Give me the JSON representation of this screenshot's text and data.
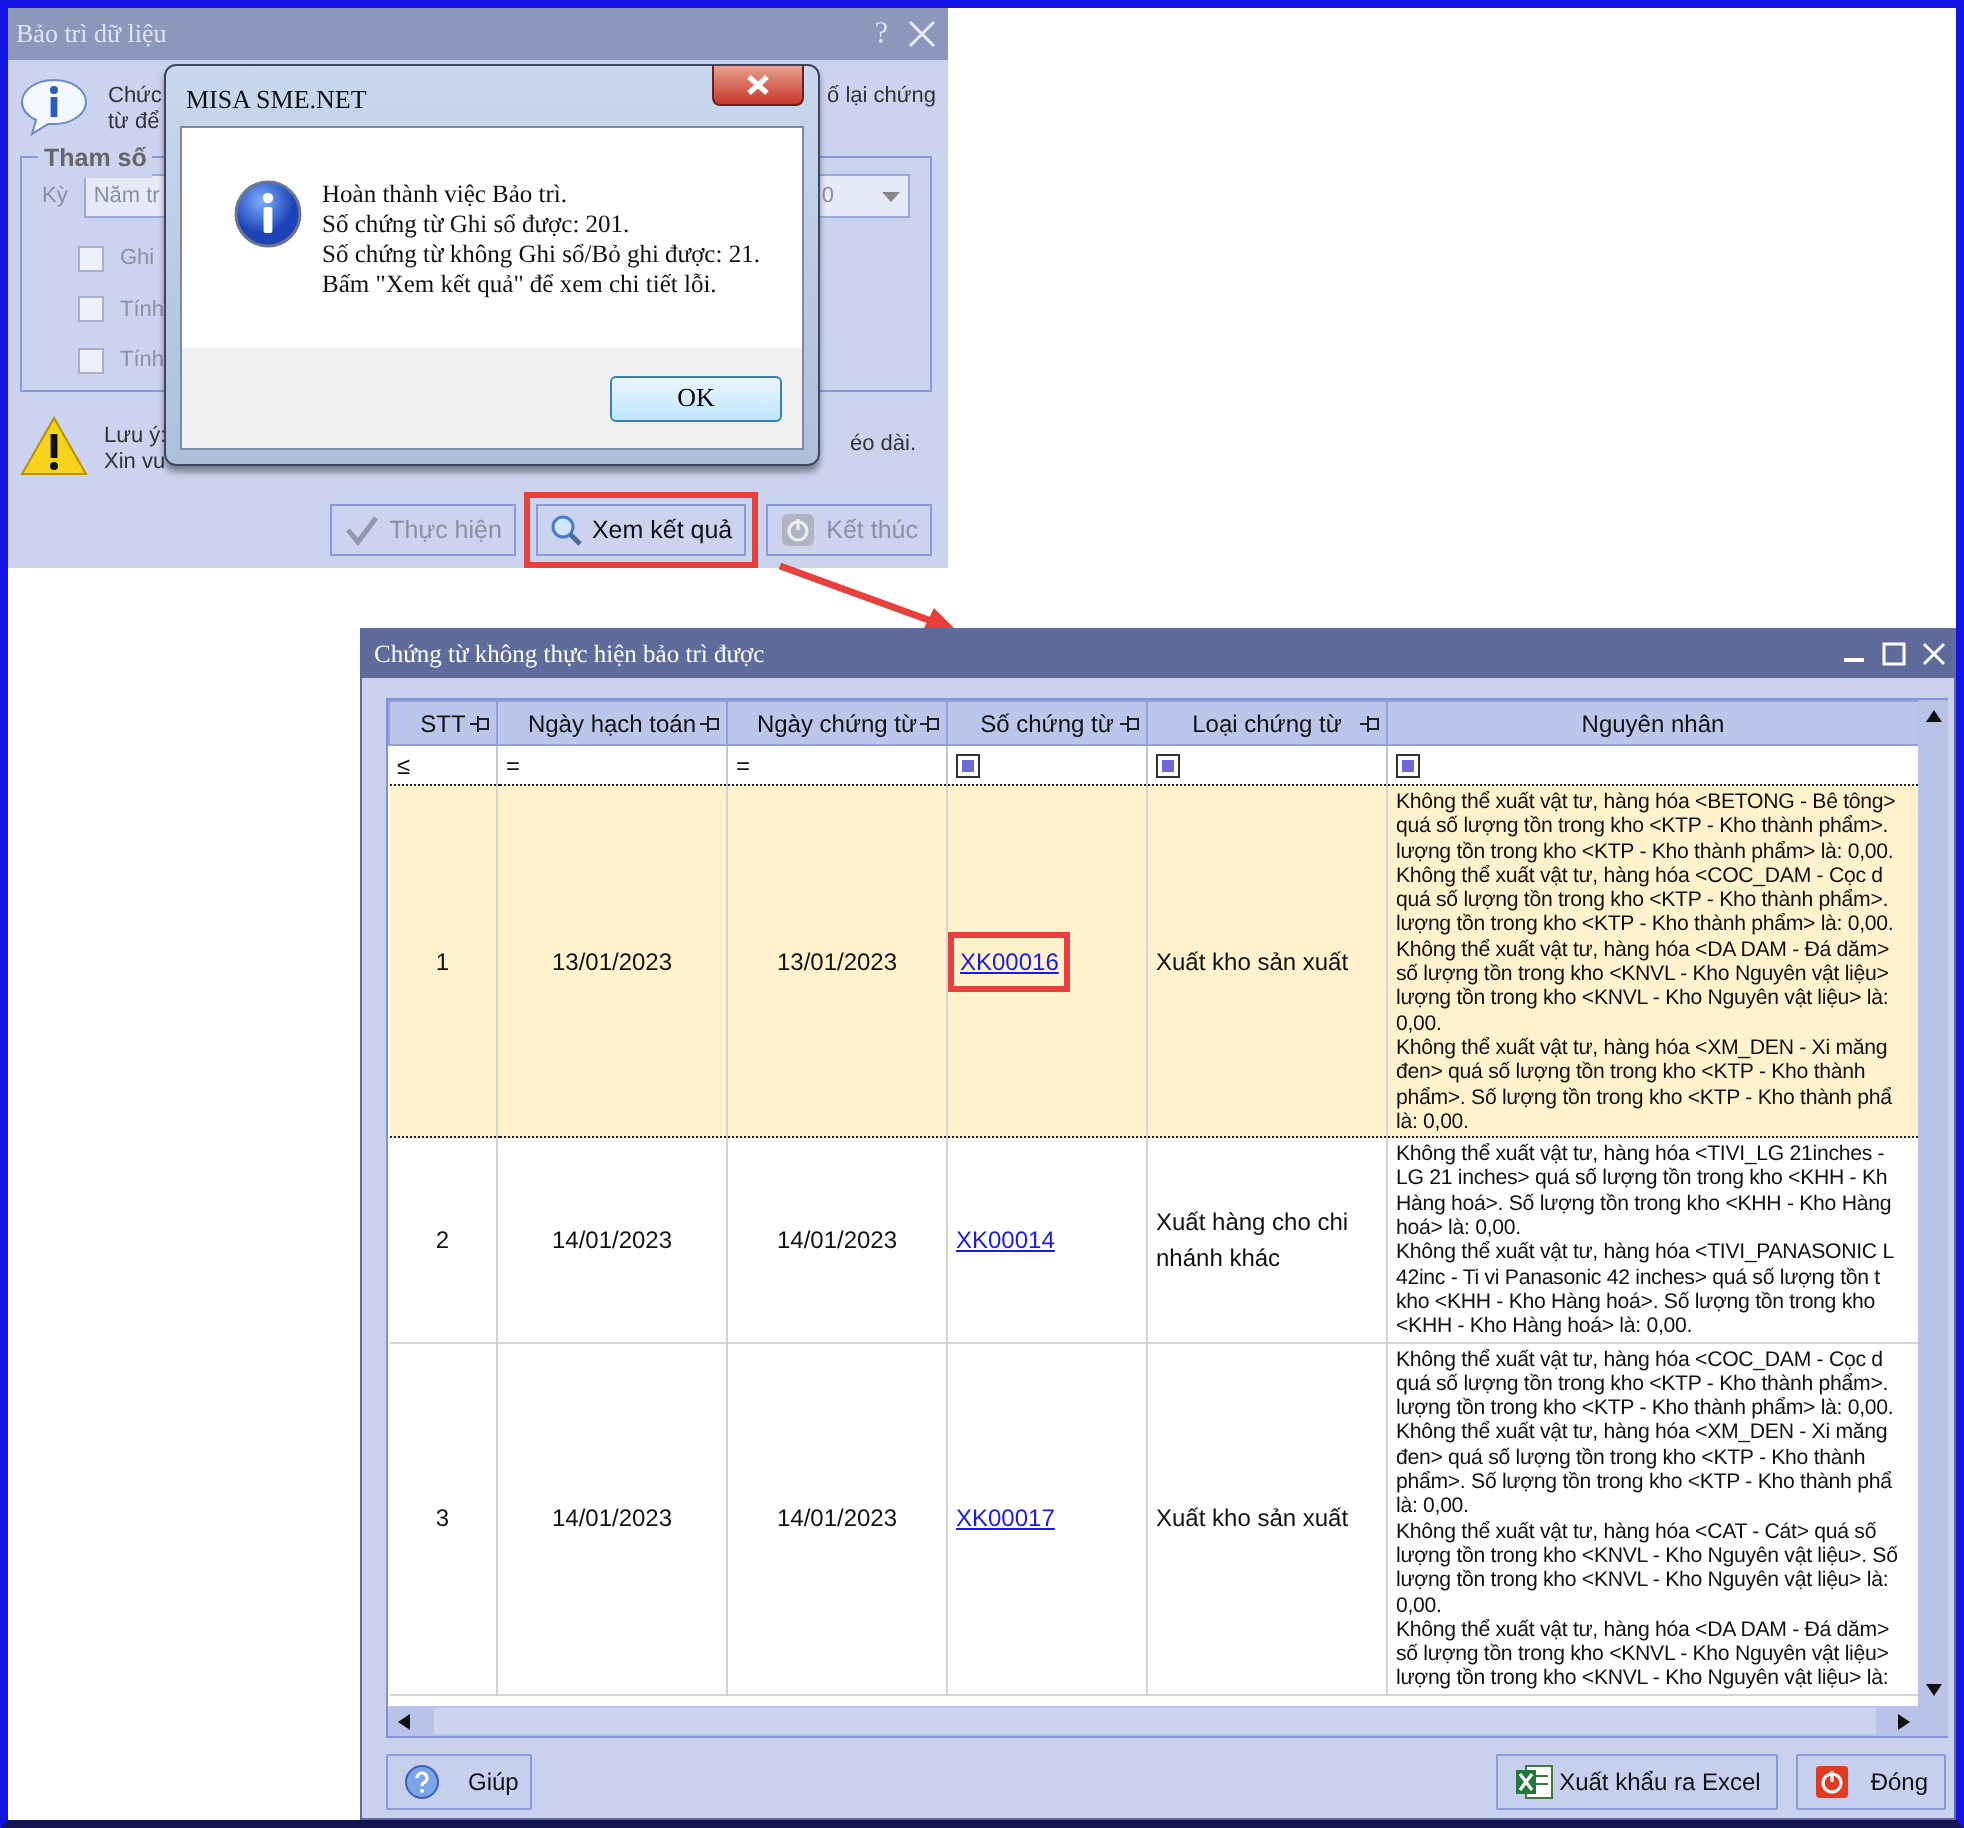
{
  "back_dialog": {
    "title": "Bảo trì dữ liệu",
    "help_mark": "?",
    "intro_lines": [
      "Chức",
      "từ để"
    ],
    "intro_tail": "ố lại chứng",
    "group_title": "Tham số",
    "period_label": "Kỳ",
    "period_value": "Năm tr",
    "period_tail": "0",
    "options": [
      {
        "label": "Ghi",
        "checked": false
      },
      {
        "label": "Tính",
        "checked": false
      },
      {
        "label": "Tính",
        "checked": false
      }
    ],
    "note_lines": [
      "Lưu ý:",
      "Xin vu"
    ],
    "note_tail": "éo dài.",
    "buttons": [
      {
        "label": "Thực hiện",
        "kind": "run",
        "disabled": true,
        "highlighted": false
      },
      {
        "label": "Xem kết quả",
        "kind": "view",
        "disabled": false,
        "highlighted": true
      },
      {
        "label": "Kết thúc",
        "kind": "stop",
        "disabled": true,
        "highlighted": false
      }
    ]
  },
  "message_box": {
    "title": "MISA SME.NET",
    "lines": [
      "Hoàn thành việc Bảo trì.",
      "Số chứng từ Ghi sổ được: 201.",
      "Số chứng từ không Ghi sổ/Bỏ ghi được: 21.",
      "Bấm \"Xem kết quả\" để xem chi tiết lỗi."
    ],
    "button": "OK"
  },
  "result_window": {
    "title": "Chứng từ không thực hiện bảo trì được",
    "columns": [
      {
        "label": "STT",
        "pin": true,
        "filter": {
          "kind": "op",
          "text": "≤"
        }
      },
      {
        "label": "Ngày hạch toán",
        "pin": true,
        "filter": {
          "kind": "op",
          "text": "="
        }
      },
      {
        "label": "Ngày chứng từ",
        "pin": true,
        "filter": {
          "kind": "op",
          "text": "="
        }
      },
      {
        "label": "Số chứng từ",
        "pin": true,
        "filter": {
          "kind": "box"
        }
      },
      {
        "label": "Loại chứng từ",
        "pin": true,
        "filter": {
          "kind": "box"
        }
      },
      {
        "label": "Nguyên nhân",
        "pin": false,
        "filter": {
          "kind": "box"
        }
      }
    ],
    "rows": [
      {
        "stt": "1",
        "posting_date": "13/01/2023",
        "voucher_date": "13/01/2023",
        "voucher_no": "XK00016",
        "voucher_type": "Xuất kho sản xuất",
        "selected": true,
        "highlighted": true,
        "reason_lines": [
          "Không thể xuất vật tư, hàng hóa <BETONG - Bê tông>",
          "quá số lượng tồn trong kho <KTP - Kho thành phẩm>.",
          "lượng tồn trong kho <KTP - Kho thành phẩm> là: 0,00.",
          "Không thể xuất vật tư, hàng hóa <COC_DAM - Cọc d",
          "quá số lượng tồn trong kho <KTP - Kho thành phẩm>.",
          "lượng tồn trong kho <KTP - Kho thành phẩm> là: 0,00.",
          "Không thể xuất vật tư, hàng hóa <DA DAM - Đá dăm>",
          "số lượng tồn trong kho <KNVL - Kho Nguyên vật liệu>",
          "lượng tồn trong kho <KNVL - Kho Nguyên vật liệu> là:",
          "0,00.",
          "Không thể xuất vật tư, hàng hóa <XM_DEN - Xi măng",
          "đen> quá số lượng tồn trong kho <KTP - Kho thành",
          "phẩm>. Số lượng tồn trong kho <KTP - Kho thành phẩ",
          "là: 0,00."
        ]
      },
      {
        "stt": "2",
        "posting_date": "14/01/2023",
        "voucher_date": "14/01/2023",
        "voucher_no": "XK00014",
        "voucher_type": "Xuất hàng cho chi nhánh khác",
        "selected": false,
        "highlighted": false,
        "reason_lines": [
          "Không thể xuất vật tư, hàng hóa <TIVI_LG 21inches -",
          "LG 21 inches> quá số lượng tồn trong kho <KHH - Kh",
          "Hàng hoá>. Số lượng tồn trong kho <KHH - Kho Hàng",
          "hoá> là: 0,00.",
          "Không thể xuất vật tư, hàng hóa <TIVI_PANASONIC L",
          "42inc - Ti vi Panasonic 42 inches> quá số lượng tồn t",
          "kho <KHH - Kho Hàng hoá>. Số lượng tồn trong kho",
          "<KHH - Kho Hàng hoá> là: 0,00."
        ]
      },
      {
        "stt": "3",
        "posting_date": "14/01/2023",
        "voucher_date": "14/01/2023",
        "voucher_no": "XK00017",
        "voucher_type": "Xuất kho sản xuất",
        "selected": false,
        "highlighted": false,
        "reason_lines": [
          "Không thể xuất vật tư, hàng hóa <COC_DAM - Cọc d",
          "quá số lượng tồn trong kho <KTP - Kho thành phẩm>.",
          "lượng tồn trong kho <KTP - Kho thành phẩm> là: 0,00.",
          "Không thể xuất vật tư, hàng hóa <XM_DEN - Xi măng",
          "đen> quá số lượng tồn trong kho <KTP - Kho thành",
          "phẩm>. Số lượng tồn trong kho <KTP - Kho thành phẩ",
          "là: 0,00.",
          "Không thể xuất vật tư, hàng hóa <CAT - Cát> quá số",
          "lượng tồn trong kho <KNVL - Kho Nguyên vật liệu>. Số",
          "lượng tồn trong kho <KNVL - Kho Nguyên vật liệu> là:",
          "0,00.",
          "Không thể xuất vật tư, hàng hóa <DA DAM - Đá dăm>",
          "số lượng tồn trong kho <KNVL - Kho Nguyên vật liệu>",
          "lượng tồn trong kho <KNVL - Kho Nguyên vật liệu> là:"
        ]
      }
    ],
    "buttons": [
      {
        "label": "Giúp",
        "kind": "help"
      },
      {
        "label": "Xuất khẩu ra Excel",
        "kind": "excel"
      },
      {
        "label": "Đóng",
        "kind": "close"
      }
    ]
  }
}
